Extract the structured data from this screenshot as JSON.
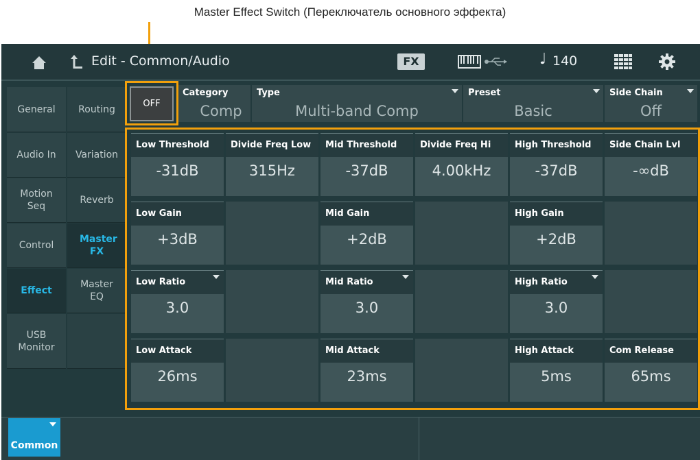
{
  "annotations": {
    "top": "Master Effect Switch (Переключатель основного эффекта)"
  },
  "topbar": {
    "title": "Edit - Common/Audio",
    "fx_badge": "FX",
    "note_symbol": "♩",
    "tempo": "140",
    "icons": [
      "home-icon",
      "back-icon",
      "keyboard-icon",
      "usb-icon",
      "grid-icon",
      "gear-icon"
    ]
  },
  "left_tabs": {
    "col1": [
      "General",
      "Audio In",
      "Motion Seq",
      "Control",
      "Effect",
      "USB Monitor"
    ],
    "col2": [
      "Routing",
      "Variation",
      "Reverb",
      "Master FX",
      "Master EQ",
      ""
    ],
    "active_col1": "Effect",
    "active_col2": "Master FX"
  },
  "header": {
    "switch": "OFF",
    "category_label": "Category",
    "category_value": "Comp",
    "type_label": "Type",
    "type_value": "Multi-band Comp",
    "preset_label": "Preset",
    "preset_value": "Basic",
    "sidechain_label": "Side Chain",
    "sidechain_value": "Off"
  },
  "params": {
    "row1": [
      {
        "label": "Low Threshold",
        "value": "-31dB"
      },
      {
        "label": "Divide Freq Low",
        "value": "315Hz"
      },
      {
        "label": "Mid Threshold",
        "value": "-37dB"
      },
      {
        "label": "Divide Freq Hi",
        "value": "4.00kHz"
      },
      {
        "label": "High Threshold",
        "value": "-37dB"
      },
      {
        "label": "Side Chain Lvl",
        "value": "-∞dB"
      }
    ],
    "row2": [
      {
        "label": "Low Gain",
        "value": "+3dB"
      },
      {
        "label": "Mid Gain",
        "value": "+2dB"
      },
      {
        "label": "High Gain",
        "value": "+2dB"
      }
    ],
    "row3": [
      {
        "label": "Low Ratio",
        "value": "3.0"
      },
      {
        "label": "Mid Ratio",
        "value": "3.0"
      },
      {
        "label": "High Ratio",
        "value": "3.0"
      }
    ],
    "row4": [
      {
        "label": "Low Attack",
        "value": "26ms"
      },
      {
        "label": "Mid Attack",
        "value": "23ms"
      },
      {
        "label": "High Attack",
        "value": "5ms"
      },
      {
        "label": "Com Release",
        "value": "65ms"
      }
    ]
  },
  "bottom": {
    "common": "Common"
  },
  "colors": {
    "accent": "#1a9bd0",
    "highlight": "#f2a00c",
    "active_text": "#28b8e6"
  }
}
